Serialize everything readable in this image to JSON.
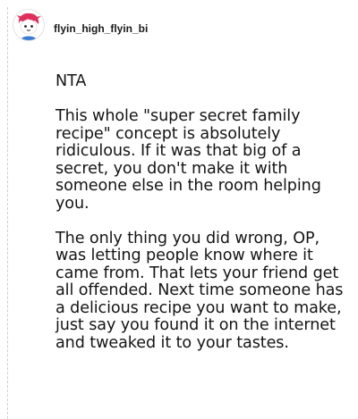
{
  "post": {
    "author": {
      "username": "flyin_high_flyin_bi",
      "avatar_icon": "avatar-icon"
    },
    "comment": {
      "verdict": "NTA",
      "paragraph1": "This whole \"super secret family recipe\" concept is absolutely ridiculous. If it was that big of a secret, you don't make it with someone else in the room helping you.",
      "paragraph2": "The only thing you did wrong, OP, was letting people know where it came from. That lets your friend get all offended. Next time someone has a delicious recipe you want to make, just say you found it on the internet and tweaked it to your tastes."
    }
  },
  "colors": {
    "background": "#ffffff",
    "text": "#151515",
    "avatar_accent": "#e0305a"
  }
}
